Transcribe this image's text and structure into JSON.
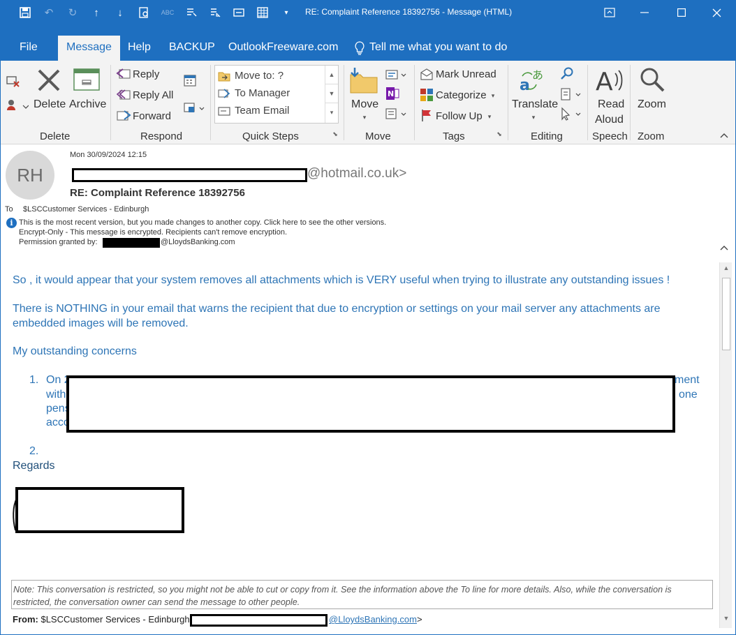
{
  "window": {
    "title": "RE: Complaint Reference 18392756  -  Message (HTML)"
  },
  "tabs": [
    {
      "label": "File"
    },
    {
      "label": "Message"
    },
    {
      "label": "Help"
    },
    {
      "label": "BACKUP"
    },
    {
      "label": "OutlookFreeware.com"
    },
    {
      "label": "Tell me what you want to do"
    }
  ],
  "ribbon": {
    "delete_group": {
      "delete": "Delete",
      "archive": "Archive",
      "label": "Delete"
    },
    "respond_group": {
      "reply": "Reply",
      "reply_all": "Reply All",
      "forward": "Forward",
      "label": "Respond"
    },
    "quick_steps": {
      "items": [
        "Move to: ?",
        "To Manager",
        "Team Email"
      ],
      "label": "Quick Steps"
    },
    "move_group": {
      "move": "Move",
      "label": "Move"
    },
    "tags_group": {
      "mark_unread": "Mark Unread",
      "categorize": "Categorize",
      "follow_up": "Follow Up",
      "label": "Tags"
    },
    "editing_group": {
      "translate": "Translate",
      "label": "Editing"
    },
    "speech_group": {
      "read": "Read",
      "aloud": "Aloud",
      "label": "Speech"
    },
    "zoom_group": {
      "zoom": "Zoom",
      "label": "Zoom"
    }
  },
  "header": {
    "avatar_initials": "RH",
    "date": "Mon 30/09/2024 12:15",
    "sender_email_suffix": "@hotmail.co.uk>",
    "subject": "RE: Complaint Reference 18392756",
    "to_label": "To",
    "to_value": "$LSCCustomer Services - Edinburgh",
    "info_line": "This is the most recent version, but you made changes to another copy. Click here to see the other versions.",
    "encrypt_line": "Encrypt-Only - This message is encrypted. Recipients can't remove encryption.",
    "permission_label": "Permission granted by:",
    "permission_domain": "@LloydsBanking.com"
  },
  "body": {
    "para1": "So , it would appear that your system removes all attachments which is VERY useful when trying to illustrate any outstanding issues !",
    "para2_line1": "There is NOTHING in your email that warns the recipient that due to encryption or settings on your mail server any attachments are",
    "para2_line2": "embedded images will be removed.",
    "para3": "My outstanding concerns",
    "item1_num": "1.",
    "item1_line1_start": "On 2",
    "item1_line1_end": "ment",
    "item1_line2_start": "with",
    "item1_line2_end": "one",
    "item1_line3_start": "pens",
    "item1_line4_start": "acco",
    "item2_num": "2.",
    "regards": "Regards",
    "note": "Note: This conversation is restricted, so you might not be able to cut or copy from it. See the information above the To line for more details. Also, while the conversation is restricted, the conversation owner can send the message to other people.",
    "from_label": "From:",
    "from_value": "$LSCCustomer Services - Edinburgh",
    "from_domain": "@LloydsBanking.com",
    "from_close": ">"
  },
  "colors": {
    "titlebar": "#1e6fc0",
    "ribbon": "#f3f3f3",
    "body_text": "#2e75b6"
  }
}
